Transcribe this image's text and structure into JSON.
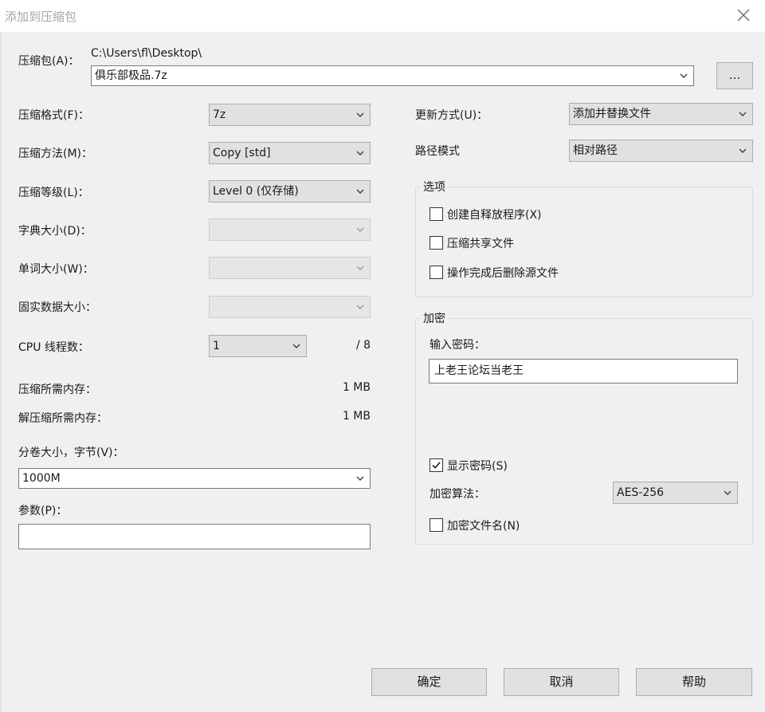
{
  "window": {
    "title": "添加到压缩包",
    "close_icon": "close-icon"
  },
  "archive": {
    "label": "压缩包(A)：",
    "path": "C:\\Users\\fl\\Desktop\\",
    "filename": "俱乐部极品.7z",
    "browse_label": "..."
  },
  "left": {
    "format_label": "压缩格式(F)：",
    "format_value": "7z",
    "method_label": "压缩方法(M)：",
    "method_value": "Copy [std]",
    "level_label": "压缩等级(L)：",
    "level_value": "Level 0 (仅存储)",
    "dict_label": "字典大小(D)：",
    "dict_value": "",
    "word_label": "单词大小(W)：",
    "word_value": "",
    "solid_label": "固实数据大小：",
    "solid_value": "",
    "cpu_label": "CPU 线程数：",
    "cpu_value": "1",
    "cpu_total": "/ 8",
    "mem_label": "压缩所需内存：",
    "mem_value": "1 MB",
    "demem_label": "解压缩所需内存：",
    "demem_value": "1 MB",
    "volume_label": "分卷大小，字节(V)：",
    "volume_value": "1000M",
    "params_label": "参数(P)：",
    "params_value": ""
  },
  "right": {
    "update_label": "更新方式(U)：",
    "update_value": "添加并替换文件",
    "path_mode_label": "路径模式",
    "path_mode_value": "相对路径",
    "options": {
      "title": "选项",
      "items": [
        {
          "label": "创建自释放程序(X)",
          "checked": false
        },
        {
          "label": "压缩共享文件",
          "checked": false
        },
        {
          "label": "操作完成后删除源文件",
          "checked": false
        }
      ]
    },
    "encryption": {
      "title": "加密",
      "password_label": "输入密码：",
      "password_value": "上老王论坛当老王",
      "show_password_label": "显示密码(S)",
      "show_password_checked": true,
      "method_label": "加密算法：",
      "method_value": "AES-256",
      "encrypt_names_label": "加密文件名(N)",
      "encrypt_names_checked": false
    }
  },
  "buttons": {
    "ok": "确定",
    "cancel": "取消",
    "help": "帮助"
  }
}
